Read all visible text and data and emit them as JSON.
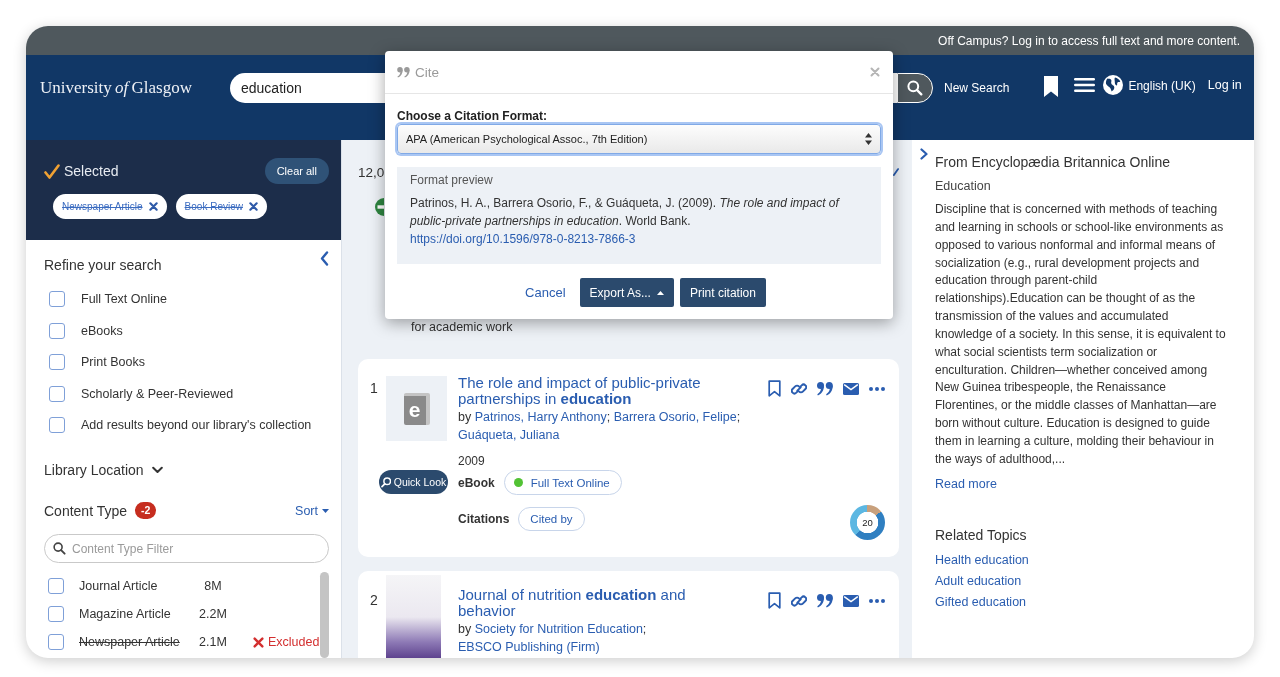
{
  "top_bar": {
    "message": "Off Campus? Log in to access full text and more content."
  },
  "header": {
    "logo": "University *of* Glasgow",
    "search": {
      "value": "education"
    },
    "new_search": "New Search",
    "language": "English (UK)",
    "login": "Log in"
  },
  "sidebar": {
    "selected": {
      "title": "Selected",
      "clear_all": "Clear all",
      "chips": [
        {
          "label": "Newspaper Article",
          "excluded": true
        },
        {
          "label": "Book Review",
          "excluded": true
        }
      ]
    },
    "refine": {
      "title": "Refine your search",
      "filters": [
        {
          "label": "Full Text Online",
          "checked": false
        },
        {
          "label": "eBooks",
          "checked": false
        },
        {
          "label": "Print Books",
          "checked": false
        },
        {
          "label": "Scholarly & Peer-Reviewed",
          "checked": false
        },
        {
          "label": "Add results beyond our library's collection",
          "checked": false
        }
      ]
    },
    "library_location": {
      "title": "Library Location",
      "expanded": false
    },
    "content_type": {
      "title": "Content Type",
      "badge": "-2",
      "sort": "Sort",
      "filter": {
        "placeholder": "Content Type Filter"
      },
      "items": [
        {
          "label": "Journal Article",
          "count": "8M",
          "checked": false,
          "excluded": false
        },
        {
          "label": "Magazine Article",
          "count": "2.2M",
          "checked": false,
          "excluded": false
        },
        {
          "label": "Newspaper Article",
          "count": "2.1M",
          "checked": false,
          "excluded": true,
          "status": "Excluded"
        }
      ]
    }
  },
  "results": {
    "count": "12,0",
    "note": "for academic work",
    "items": [
      {
        "number": "1",
        "thumbnail": {
          "kind": "format-icon",
          "glyph": "e"
        },
        "quick_look": "Quick Look",
        "title": "The role and impact of public-private partnerships in **education**",
        "by": "by",
        "authors": [
          "Patrinos, Harry Anthony",
          "Barrera Osorio, Felipe",
          "Guáqueta, Juliana"
        ],
        "separator": ";",
        "year": "2009",
        "format": "eBook",
        "availability": {
          "label": "Full Text Online",
          "color": "#52c234"
        },
        "citations_label": "Citations",
        "cited_by": "Cited by",
        "score": "20"
      },
      {
        "number": "2",
        "thumbnail": {
          "kind": "cover-image"
        },
        "title": "Journal of nutrition **education** and behavior",
        "by": "by",
        "authors": [
          "Society for Nutrition Education",
          "EBSCO Publishing (Firm)"
        ],
        "separator": ";"
      }
    ]
  },
  "topic_panel": {
    "source": "From Encyclopædia Britannica Online",
    "term": "Education",
    "summary": "Discipline that is concerned with methods of teaching and learning in schools or school-like environments as opposed to various nonformal and informal means of socialization (e.g., rural development projects and education through parent-child relationships).Education can be thought of as the transmission of the values and accumulated knowledge of a society. In this sense, it is equivalent to what social scientists term socialization or enculturation. Children—whether conceived among New Guinea tribespeople, the Renaissance Florentines, or the middle classes of Manhattan—are born without culture. Education is designed to guide them in learning a culture, molding their behaviour in the ways of adulthood,...",
    "read_more": "Read more",
    "related_title": "Related Topics",
    "related": [
      "Health education",
      "Adult education",
      "Gifted education"
    ]
  },
  "cite_dialog": {
    "title": "Cite",
    "format_label": "Choose a Citation Format:",
    "format": "APA (American Psychological Assoc., 7th Edition)",
    "preview_label": "Format preview",
    "citation": "Patrinos, H. A., Barrera Osorio, F., & Guáqueta, J. (2009). *The role and impact of public-private partnerships in education*. World Bank.",
    "citation_link": "https://doi.org/10.1596/978-0-8213-7866-3",
    "buttons": [
      {
        "label": "Cancel",
        "kind": "link"
      },
      {
        "label": "Export As...",
        "kind": "menu"
      },
      {
        "label": "Print citation",
        "kind": "primary"
      }
    ]
  }
}
